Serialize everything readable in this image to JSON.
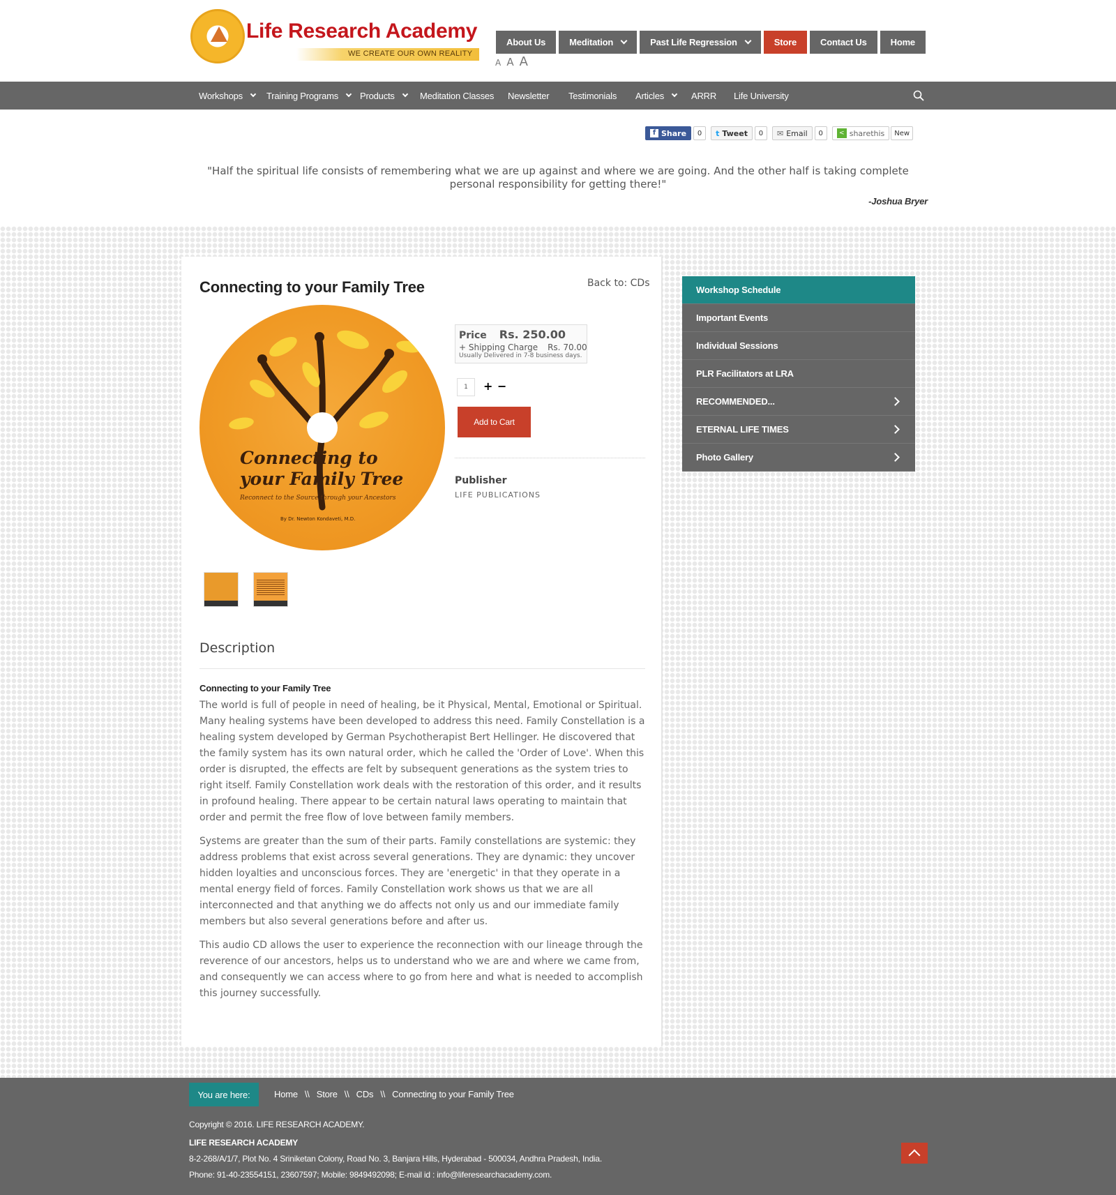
{
  "brand": {
    "name": "Life Research Academy",
    "tagline": "WE CREATE OUR OWN REALITY",
    "primary_color": "#c4161c",
    "accent_color": "#c8402a",
    "teal_color": "#1e8887",
    "nav_gray": "#666666"
  },
  "top_nav": {
    "items": [
      {
        "label": "About Us",
        "dropdown": false
      },
      {
        "label": "Meditation",
        "dropdown": true
      },
      {
        "label": "Past Life Regression",
        "dropdown": true
      },
      {
        "label": "Store",
        "dropdown": false,
        "active": true
      },
      {
        "label": "Contact Us",
        "dropdown": false
      },
      {
        "label": "Home",
        "dropdown": false
      }
    ]
  },
  "font_sizer": [
    "A",
    "A",
    "A"
  ],
  "main_nav": {
    "items": [
      {
        "label": "Workshops",
        "dropdown": true
      },
      {
        "label": "Training Programs",
        "dropdown": true
      },
      {
        "label": "Products",
        "dropdown": true
      },
      {
        "label": "Meditation Classes",
        "dropdown": false
      },
      {
        "label": "Newsletter",
        "dropdown": false
      },
      {
        "label": "Testimonials",
        "dropdown": false
      },
      {
        "label": "Articles",
        "dropdown": true
      },
      {
        "label": "ARRR",
        "dropdown": false
      },
      {
        "label": "Life University",
        "dropdown": false
      }
    ],
    "search_icon": "search-icon"
  },
  "share": {
    "facebook": {
      "label": "Share",
      "count": "0"
    },
    "twitter": {
      "label": "Tweet",
      "count": "0"
    },
    "email": {
      "label": "Email",
      "count": "0"
    },
    "sharethis": {
      "label": "sharethis",
      "badge": "New"
    }
  },
  "quote": {
    "text": "\"Half the spiritual life consists of remembering what we are up against and where we are going. And the other half is taking complete personal responsibility for getting there!\"",
    "author": "-Joshua Bryer"
  },
  "product": {
    "title": "Connecting to your Family Tree",
    "back_link": "Back to: CDs",
    "cd_art": {
      "title": "Connecting to your Family Tree",
      "subtitle": "Reconnect to the Source through your Ancestors",
      "author": "By Dr. Newton Kondaveti, M.D."
    },
    "price_label": "Price",
    "price": "Rs. 250.00",
    "shipping_label": "+ Shipping Charge",
    "shipping": "Rs. 70.00",
    "delivery": "Usually Delivered in 7-8 business days.",
    "quantity": "1",
    "plus": "+",
    "minus": "−",
    "add_to_cart": "Add to Cart",
    "publisher_label": "Publisher",
    "publisher": "LIFE PUBLICATIONS"
  },
  "description": {
    "heading": "Description",
    "title": "Connecting to your Family Tree",
    "paragraphs": [
      "The world is full of people in need of healing, be it Physical, Mental, Emotional or Spiritual. Many healing systems have been developed to address this need. Family Constellation is a healing system developed by German Psychotherapist Bert Hellinger. He discovered that the family system has its own natural order, which he called the 'Order of Love'.  When this order is disrupted, the effects are felt by subsequent generations as the system tries to right itself. Family Constellation work deals with the restoration of this order, and it results in profound healing. There appear to be certain natural laws operating to maintain that order and permit the free flow of love between family members.",
      "Systems are greater than the sum of their parts.  Family constellations are systemic: they address problems that exist across several generations.  They are dynamic: they uncover hidden loyalties and unconscious forces.  They are 'energetic' in that they operate in a mental energy field of forces. Family Constellation work shows us that we are all interconnected and that anything we do affects not only us and our immediate family members but also several generations before and after us.",
      "This audio CD allows the user to experience the reconnection with our lineage through the reverence of our ancestors, helps us to understand who we are and where we came from, and consequently we can access where to go from here and what is needed to accomplish this journey successfully."
    ]
  },
  "sidebar": {
    "items": [
      {
        "label": "Workshop Schedule",
        "arrow": false
      },
      {
        "label": "Important Events",
        "arrow": false
      },
      {
        "label": "Individual Sessions",
        "arrow": false
      },
      {
        "label": "PLR Facilitators at LRA",
        "arrow": false
      },
      {
        "label": "RECOMMENDED...",
        "arrow": true
      },
      {
        "label": "ETERNAL LIFE TIMES",
        "arrow": true
      },
      {
        "label": "Photo Gallery",
        "arrow": true
      }
    ]
  },
  "footer": {
    "you_are_here": "You are here:",
    "breadcrumb": [
      "Home",
      "Store",
      "CDs",
      "Connecting to your Family Tree"
    ],
    "separator": "\\\\",
    "copyright": "Copyright © 2016. LIFE RESEARCH ACADEMY.",
    "org": "LIFE RESEARCH ACADEMY",
    "address": "8-2-268/A/1/7, Plot No. 4 Sriniketan Colony, Road No. 3, Banjara Hills, Hyderabad - 500034, Andhra Pradesh, India.",
    "contact": "Phone: 91-40-23554151, 23607597; Mobile: 9849492098; E-mail id : info@liferesearchacademy.com."
  }
}
